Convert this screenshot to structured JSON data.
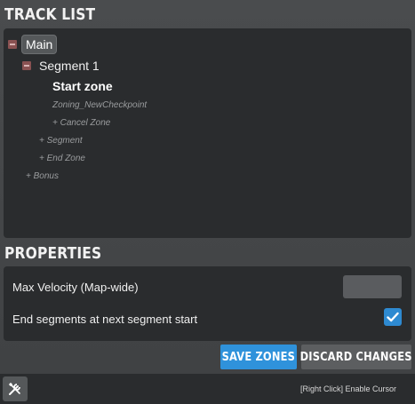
{
  "track_list": {
    "title": "TRACK LIST",
    "tree": {
      "main": "Main",
      "segment": "Segment 1",
      "start_zone": "Start zone",
      "checkpoint": "Zoning_NewCheckpoint",
      "cancel_zone": "+ Cancel Zone",
      "add_segment": "+ Segment",
      "end_zone": "+ End Zone",
      "bonus": "+ Bonus"
    }
  },
  "properties": {
    "title": "PROPERTIES",
    "max_velocity_label": "Max Velocity (Map-wide)",
    "max_velocity_value": "",
    "end_segments_label": "End segments at next segment start",
    "end_segments_checked": true
  },
  "actions": {
    "save": "SAVE ZONES",
    "discard": "DISCARD CHANGES"
  },
  "footer": {
    "hint": "[Right Click] Enable Cursor",
    "tool_icon": "wrench-screwdriver-icon"
  },
  "colors": {
    "accent_blue": "#2f92db",
    "collapse_red": "#8a5252",
    "panel_dark": "#2a2c2e"
  }
}
